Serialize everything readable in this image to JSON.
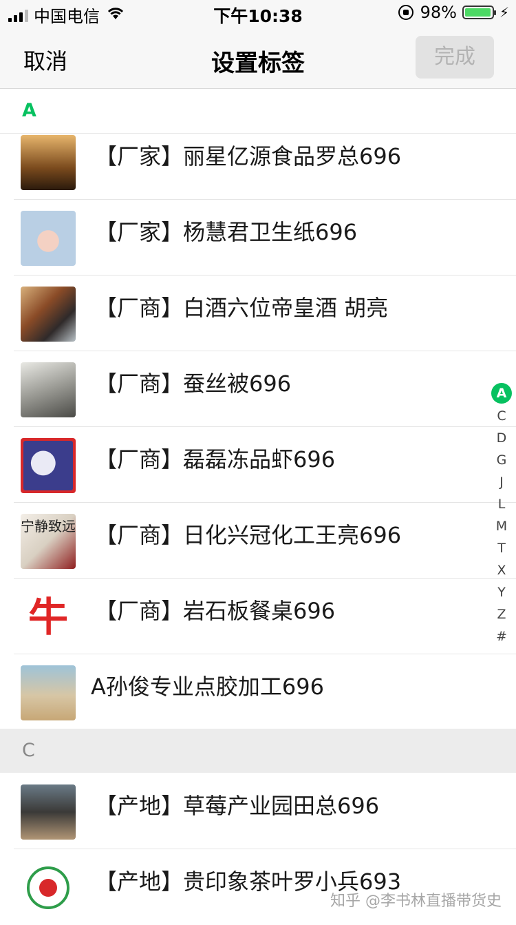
{
  "status_bar": {
    "carrier": "中国电信",
    "time": "下午10:38",
    "battery": "98%",
    "battery_level": 0.98
  },
  "nav": {
    "cancel": "取消",
    "title": "设置标签",
    "done": "完成"
  },
  "sections": [
    {
      "letter": "A",
      "contacts": [
        {
          "name": "【厂家】丽星亿源食品罗总696",
          "avatar": "couple-sunset-photo"
        },
        {
          "name": "【厂家】杨慧君卫生纸696",
          "avatar": "baby-photo"
        },
        {
          "name": "【厂商】白酒六位帝皇酒 胡亮",
          "avatar": "liquor-bottle-photo"
        },
        {
          "name": "【厂商】蚕丝被696",
          "avatar": "ink-painting"
        },
        {
          "name": "【厂商】磊磊冻品虾696",
          "avatar": "moon-rabbit-flag"
        },
        {
          "name": "【厂商】日化兴冠化工王亮696",
          "avatar": "calligraphy-poster",
          "avatar_text": "宁静致远"
        },
        {
          "name": "【厂商】岩石板餐桌696",
          "avatar": "red-bull-logo",
          "avatar_text": "牛"
        },
        {
          "name": "A孙俊专业点胶加工696",
          "avatar": "beach-hand-photo"
        }
      ]
    },
    {
      "letter": "C",
      "contacts": [
        {
          "name": "【产地】草莓产业园田总696",
          "avatar": "man-photo"
        },
        {
          "name": "【产地】贵印象茶叶罗小兵693",
          "avatar": "tea-logo"
        }
      ]
    }
  ],
  "index_letters": [
    "A",
    "C",
    "D",
    "G",
    "J",
    "L",
    "M",
    "T",
    "X",
    "Y",
    "Z",
    "#"
  ],
  "index_active": "A",
  "watermark": "知乎 @李书林直播带货史"
}
